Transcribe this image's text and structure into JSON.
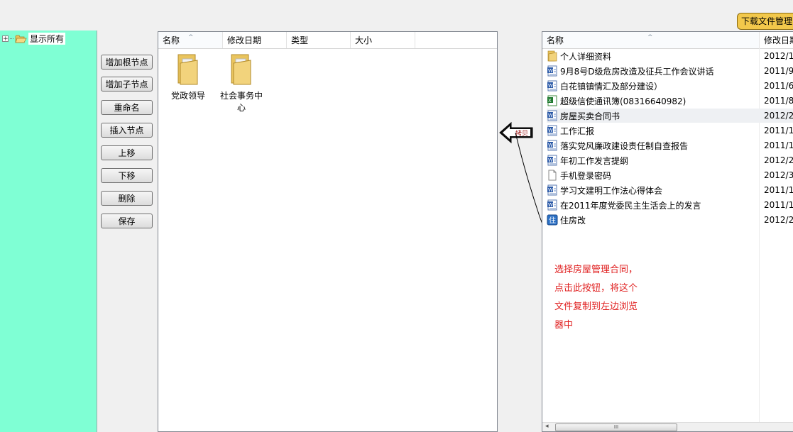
{
  "tree": {
    "root_label": "显示所有",
    "expander": "+"
  },
  "buttons": {
    "add_root": "增加根节点",
    "add_child": "增加子节点",
    "rename": "重命名",
    "insert": "插入节点",
    "move_up": "上移",
    "move_down": "下移",
    "delete": "删除",
    "save": "保存"
  },
  "middle": {
    "columns": [
      "名称",
      "修改日期",
      "类型",
      "大小"
    ],
    "folders": [
      "党政领导",
      "社会事务中心"
    ]
  },
  "right": {
    "columns": [
      "名称",
      "修改日期"
    ],
    "files": [
      {
        "name": "个人详细资料",
        "date": "2012/1",
        "icon": "folder-icon"
      },
      {
        "name": "9月8号D级危房改造及征兵工作会议讲话",
        "date": "2011/9",
        "icon": "word-doc-icon"
      },
      {
        "name": "白花镇镇情汇及部分建设）",
        "date": "2011/6",
        "icon": "word-doc-icon"
      },
      {
        "name": "超级信使通讯簿(08316640982)",
        "date": "2011/8",
        "icon": "excel-doc-icon"
      },
      {
        "name": "房屋买卖合同书",
        "date": "2012/2",
        "icon": "word-doc-icon"
      },
      {
        "name": "工作汇报",
        "date": "2011/1",
        "icon": "word-doc-icon"
      },
      {
        "name": "落实党风廉政建设责任制自查报告",
        "date": "2011/1",
        "icon": "word-doc-icon"
      },
      {
        "name": "年初工作发言提纲",
        "date": "2012/2",
        "icon": "word-doc-icon"
      },
      {
        "name": "手机登录密码",
        "date": "2012/3",
        "icon": "text-doc-icon"
      },
      {
        "name": "学习文建明工作法心得体会",
        "date": "2011/1",
        "icon": "word-doc-icon"
      },
      {
        "name": "在2011年度党委民主生活会上的发言",
        "date": "2011/1",
        "icon": "word-doc-icon"
      },
      {
        "name": "住房改",
        "date": "2012/2",
        "icon": "app-icon"
      }
    ],
    "selected_index": 4,
    "scroll_thumb_label": "III"
  },
  "download_tab": {
    "label": "下载文件管理"
  },
  "copy_button": {
    "label": "拷贝"
  },
  "annotation": {
    "lines": [
      "选择房屋管理合同，",
      "点击此按钮，将这个",
      "文件复制到左边浏览",
      "器中"
    ]
  },
  "colors": {
    "tree_bg": "#7fffd4",
    "annotation": "#e02020",
    "tab": "#f2c84b"
  }
}
